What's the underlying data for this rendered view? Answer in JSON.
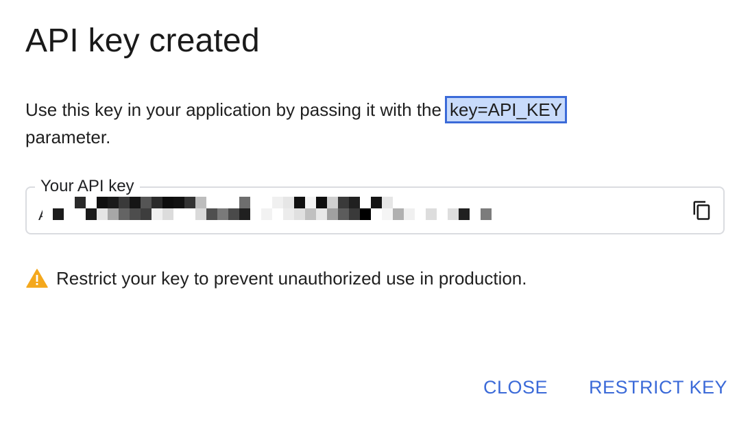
{
  "dialog": {
    "title": "API key created",
    "description_before": "Use this key in your application by passing it with the",
    "description_code": "key=API_KEY",
    "description_after": "parameter.",
    "field": {
      "label": "Your API key",
      "value_prefix": "A",
      "value_redacted": true,
      "copy_icon": "copy-icon"
    },
    "warning": {
      "icon": "warning-triangle-icon",
      "text": "Restrict your key to prevent unauthorized use in production."
    },
    "actions": {
      "close_label": "CLOSE",
      "restrict_label": "RESTRICT KEY"
    }
  },
  "colors": {
    "accent": "#3b6ad8",
    "highlight_bg": "#c8dbfb",
    "warning": "#f4a81d",
    "border": "#dadce0"
  }
}
